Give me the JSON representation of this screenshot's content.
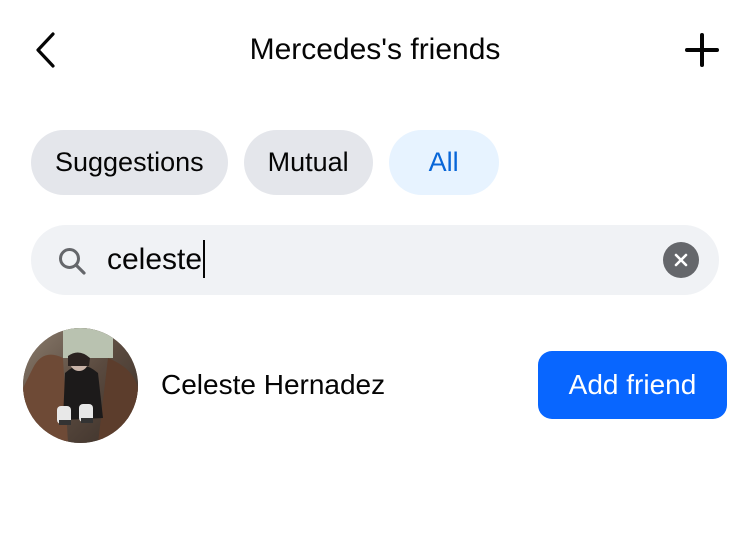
{
  "header": {
    "title": "Mercedes's friends",
    "back_icon": "chevron-left-icon",
    "add_icon": "plus-icon"
  },
  "tabs": [
    {
      "label": "Suggestions",
      "active": false
    },
    {
      "label": "Mutual",
      "active": false
    },
    {
      "label": "All",
      "active": true
    }
  ],
  "search": {
    "value": "celeste",
    "icon": "search-icon",
    "clear_icon": "close-icon"
  },
  "results": [
    {
      "name": "Celeste Hernadez",
      "action_label": "Add friend"
    }
  ],
  "colors": {
    "accent": "#0866ff",
    "active_tab_bg": "#e7f3ff",
    "active_tab_text": "#0866d8",
    "tab_bg": "#e4e6eb",
    "search_bg": "#f0f2f5"
  }
}
